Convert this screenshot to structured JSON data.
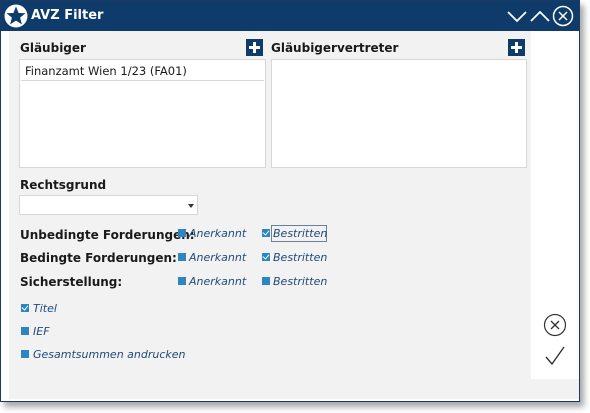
{
  "window": {
    "title": "AVZ Filter",
    "titlebar_color": "#0f3b6b",
    "icons": [
      "star-icon",
      "collapse-icon",
      "expand-icon",
      "close-icon"
    ]
  },
  "glaeubiger": {
    "label": "Gläubiger",
    "items": [
      "Finanzamt Wien 1/23 (FA01)"
    ]
  },
  "vertreter": {
    "label": "Gläubigervertreter",
    "items": []
  },
  "rechtsgrund": {
    "label": "Rechtsgrund",
    "value": ""
  },
  "forderungen": {
    "rows": [
      {
        "label": "Unbedingte Forderungen:",
        "anerkannt": {
          "label": "Anerkannt",
          "checked": false
        },
        "bestritten": {
          "label": "Bestritten",
          "checked": true
        }
      },
      {
        "label": "Bedingte Forderungen:",
        "anerkannt": {
          "label": "Anerkannt",
          "checked": false
        },
        "bestritten": {
          "label": "Bestritten",
          "checked": true
        }
      },
      {
        "label": "Sicherstellung:",
        "anerkannt": {
          "label": "Anerkannt",
          "checked": false
        },
        "bestritten": {
          "label": "Bestritten",
          "checked": false
        }
      }
    ]
  },
  "options": [
    {
      "label": "Titel",
      "checked": true
    },
    {
      "label": "IEF",
      "checked": false
    },
    {
      "label": "Gesamtsummen andrucken",
      "checked": false
    }
  ],
  "actions": {
    "cancel_icon": "cancel-icon",
    "confirm_icon": "confirm-icon"
  },
  "colors": {
    "checkbox": "#2e86c1",
    "option_text": "#1f4a7a",
    "panel_bg": "#f2f2f2"
  }
}
